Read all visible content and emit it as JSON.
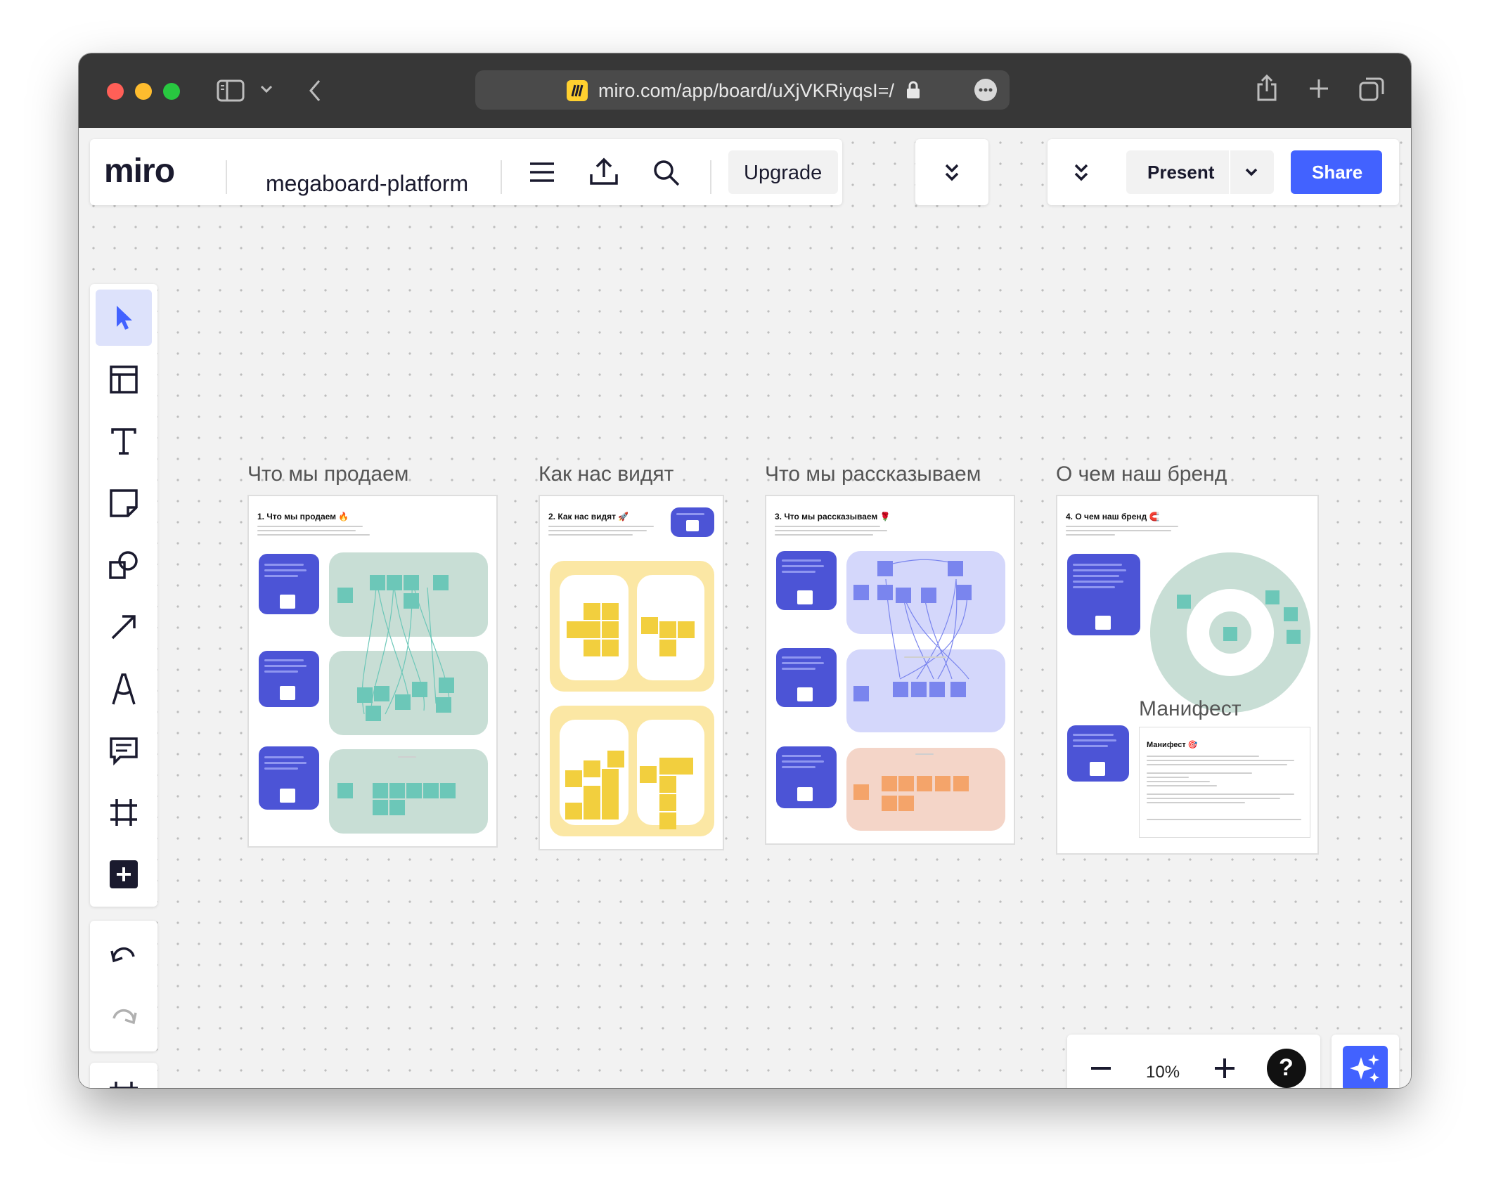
{
  "browser": {
    "url": "miro.com/app/board/uXjVKRiyqsI=/"
  },
  "toolbar": {
    "logo": "miro",
    "board_name": "megaboard-platform",
    "upgrade_label": "Upgrade",
    "present_label": "Present",
    "share_label": "Share"
  },
  "tools": [
    "select",
    "templates",
    "text",
    "sticky-note",
    "shapes",
    "connection-line",
    "pen",
    "comment",
    "frame",
    "more-apps",
    "undo",
    "redo",
    "frames-panel"
  ],
  "zoom": {
    "level": "10%"
  },
  "frames": [
    {
      "label": "Что мы продаем",
      "heading": "1. Что мы продаем 🔥"
    },
    {
      "label": "Как нас видят",
      "heading": "2. Как нас видят 🚀"
    },
    {
      "label": "Что мы рассказываем",
      "heading": "3. Что мы рассказываем 🌹"
    },
    {
      "label": "О чем наш бренд",
      "heading": "4. О чем наш бренд 🧲"
    }
  ],
  "manifest": {
    "label": "Манифест",
    "heading": "Манифест 🎯"
  },
  "colors": {
    "accent": "#4262ff",
    "green_zone": "#c8ded5",
    "green_note": "#6cc7b8",
    "blue_zone": "#d4d7fb",
    "blue_note": "#7a85ee",
    "peach_zone": "#f4d5c8",
    "orange_note": "#f4a46a",
    "yellow_zone": "#fbe7a4",
    "yellow_note": "#f2cf3e",
    "indigo_card": "#4c54d6"
  }
}
